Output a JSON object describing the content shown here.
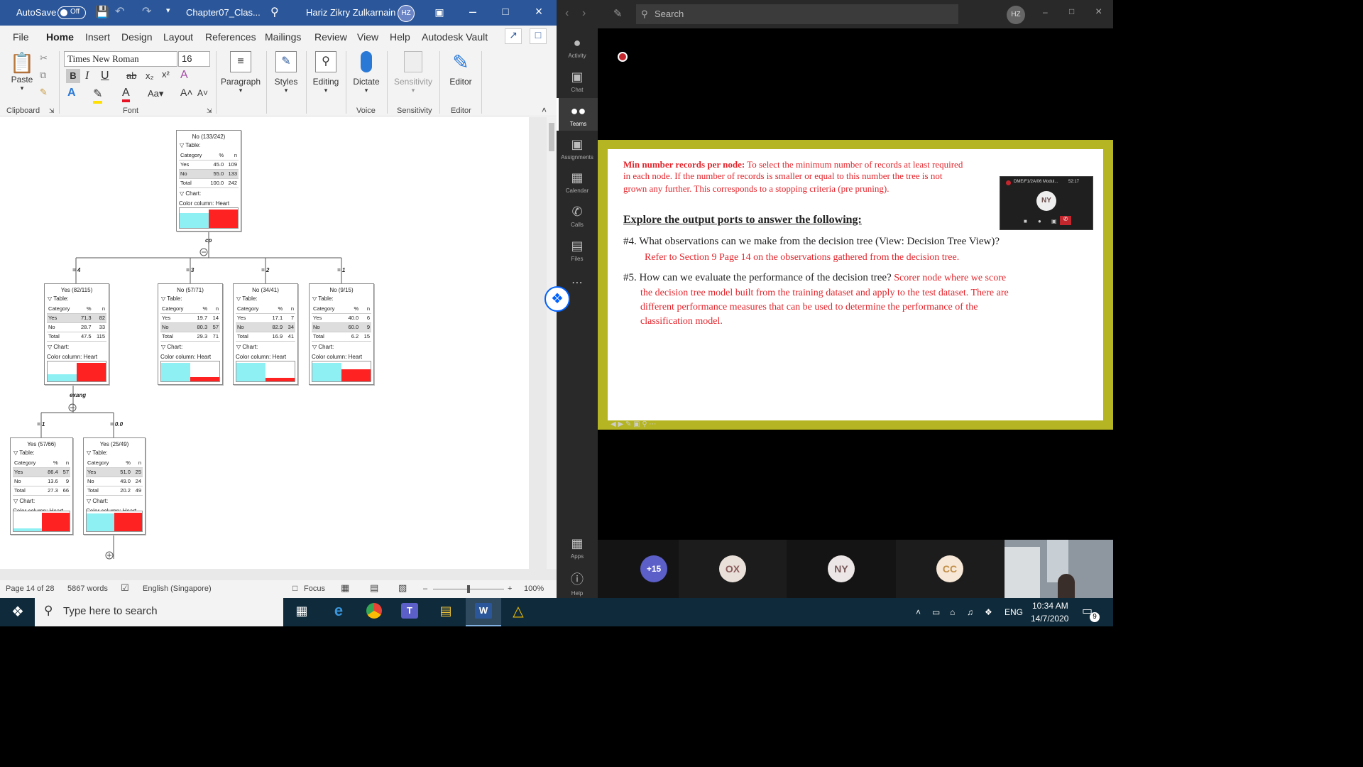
{
  "word": {
    "autosave_label": "AutoSave",
    "autosave_state": "Off",
    "doc_title": "Chapter07_Clas...",
    "user_name": "Hariz Zikry Zulkarnain",
    "user_initials": "HZ",
    "menu": [
      "File",
      "Home",
      "Insert",
      "Design",
      "Layout",
      "References",
      "Mailings",
      "Review",
      "View",
      "Help",
      "Autodesk Vault"
    ],
    "active_menu": "Home",
    "ribbon": {
      "paste": "Paste",
      "font_name": "Times New Roman",
      "font_size": "16",
      "paragraph": "Paragraph",
      "styles": "Styles",
      "editing": "Editing",
      "dictate": "Dictate",
      "sensitivity_btn": "Sensitivity",
      "editor_btn": "Editor",
      "groups": {
        "clipboard": "Clipboard",
        "font": "Font",
        "voice": "Voice",
        "sensitivity": "Sensitivity",
        "editor": "Editor"
      }
    },
    "status": {
      "page": "Page 14 of 28",
      "words": "5867 words",
      "language": "English (Singapore)",
      "focus": "Focus",
      "zoom": "100%"
    }
  },
  "tree": {
    "common": {
      "table_label": "Table:",
      "chart_label": "Chart:",
      "category": "Category",
      "pct": "%",
      "n": "n",
      "yes": "Yes",
      "no": "No",
      "total": "Total",
      "color_col": "Color column: Heart"
    },
    "root": {
      "title": "No (133/242)",
      "yes_pct": "45.0",
      "yes_n": "109",
      "no_pct": "55.0",
      "no_n": "133",
      "tot_pct": "100.0",
      "tot_n": "242",
      "yes_frac": 0.45
    },
    "split1_attr": "cp",
    "branches": [
      {
        "edge": "= 4",
        "title": "Yes (82/115)",
        "yes_pct": "71.3",
        "yes_n": "82",
        "no_pct": "28.7",
        "no_n": "33",
        "tot_pct": "47.5",
        "tot_n": "115",
        "yes_frac": 0.287,
        "hl": "yes"
      },
      {
        "edge": "= 3",
        "title": "No (57/71)",
        "yes_pct": "19.7",
        "yes_n": "14",
        "no_pct": "80.3",
        "no_n": "57",
        "tot_pct": "29.3",
        "tot_n": "71",
        "yes_frac": 0.803,
        "hl": "no"
      },
      {
        "edge": "= 2",
        "title": "No (34/41)",
        "yes_pct": "17.1",
        "yes_n": "7",
        "no_pct": "82.9",
        "no_n": "34",
        "tot_pct": "16.9",
        "tot_n": "41",
        "yes_frac": 0.829,
        "hl": "no"
      },
      {
        "edge": "= 1",
        "title": "No (9/15)",
        "yes_pct": "40.0",
        "yes_n": "6",
        "no_pct": "60.0",
        "no_n": "9",
        "tot_pct": "6.2",
        "tot_n": "15",
        "yes_frac": 0.6,
        "hl": "no"
      }
    ],
    "split2_attr": "exang",
    "leaves": [
      {
        "edge": "= 1",
        "title": "Yes (57/66)",
        "yes_pct": "86.4",
        "yes_n": "57",
        "no_pct": "13.6",
        "no_n": "9",
        "tot_pct": "27.3",
        "tot_n": "66",
        "yes_frac": 0.136,
        "hl": "yes"
      },
      {
        "edge": "= 0.0",
        "title": "Yes (25/49)",
        "yes_pct": "51.0",
        "yes_n": "25",
        "no_pct": "49.0",
        "no_n": "24",
        "tot_pct": "20.2",
        "tot_n": "49",
        "yes_frac": 0.49,
        "hl": "yes"
      }
    ]
  },
  "teams": {
    "search_placeholder": "Search",
    "user_initials": "HZ",
    "rail": [
      "Activity",
      "Chat",
      "Teams",
      "Assignments",
      "Calendar",
      "Calls",
      "Files",
      "Apps",
      "Help"
    ],
    "pip_title": "DME/F1/2A/06 Modul...",
    "pip_time": "52:17",
    "pip_initials": "NY",
    "participants": {
      "overflow": "+15",
      "a": "OX",
      "b": "NY",
      "c": "CC"
    }
  },
  "slide": {
    "min_rec_label": "Min number records per node:",
    "min_rec_text1": " To select the minimum number of records at least required",
    "min_rec_text2": "in each node. If the number of records is smaller or equal to this number the tree is not",
    "min_rec_text3": "grown any further. This corresponds to a stopping criteria (pre pruning).",
    "heading": "Explore the output ports to answer the following:",
    "q4": "#4. What observations can we make from the decision tree (View: Decision Tree View)?",
    "a4": "Refer to Section 9 Page 14 on the observations gathered from the decision tree.",
    "q5": "#5. How can we evaluate the performance of the decision tree?",
    "a5_1": " Scorer node where we score",
    "a5_2": "the decision tree model built from the training dataset and apply to the test dataset. There are",
    "a5_3": "different performance measures that can be used to determine the performance of the",
    "a5_4": "classification model."
  },
  "taskbar": {
    "search_placeholder": "Type here to search",
    "lang": "ENG",
    "time": "10:34 AM",
    "date": "14/7/2020",
    "notif_count": "9"
  },
  "colors": {
    "word_blue": "#2b579a",
    "teams_dark": "#292929",
    "slide_border": "#b5b523",
    "slide_red": "#e3242b",
    "bar_cyan": "#8ff0f4",
    "bar_red": "#ff2020"
  }
}
